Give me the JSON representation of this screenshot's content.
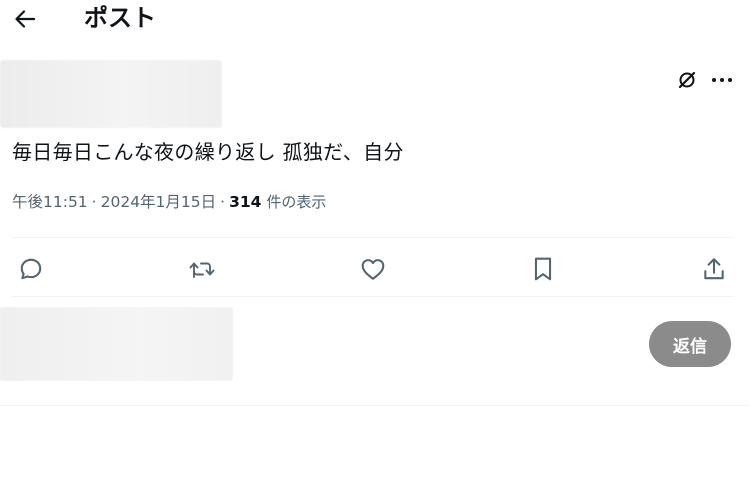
{
  "header": {
    "back_icon": "arrow-left-icon",
    "title": "ポスト"
  },
  "post": {
    "text": "毎日毎日こんな夜の繰り返し 孤独だ、自分",
    "time": "午後11:51",
    "date": "2024年1月15日",
    "separator": "·",
    "views_count": "314",
    "views_label": "件の表示",
    "top_icons": [
      "grok-icon",
      "more-icon"
    ]
  },
  "actions": {
    "icons": [
      "reply-icon",
      "repost-icon",
      "like-icon",
      "bookmark-icon",
      "share-icon"
    ]
  },
  "composer": {
    "reply_button_label": "返信",
    "reply_button_color": "#8b8b8b"
  },
  "colors": {
    "text": "#0f1419",
    "secondary": "#536471",
    "divider": "#eff3f4"
  }
}
